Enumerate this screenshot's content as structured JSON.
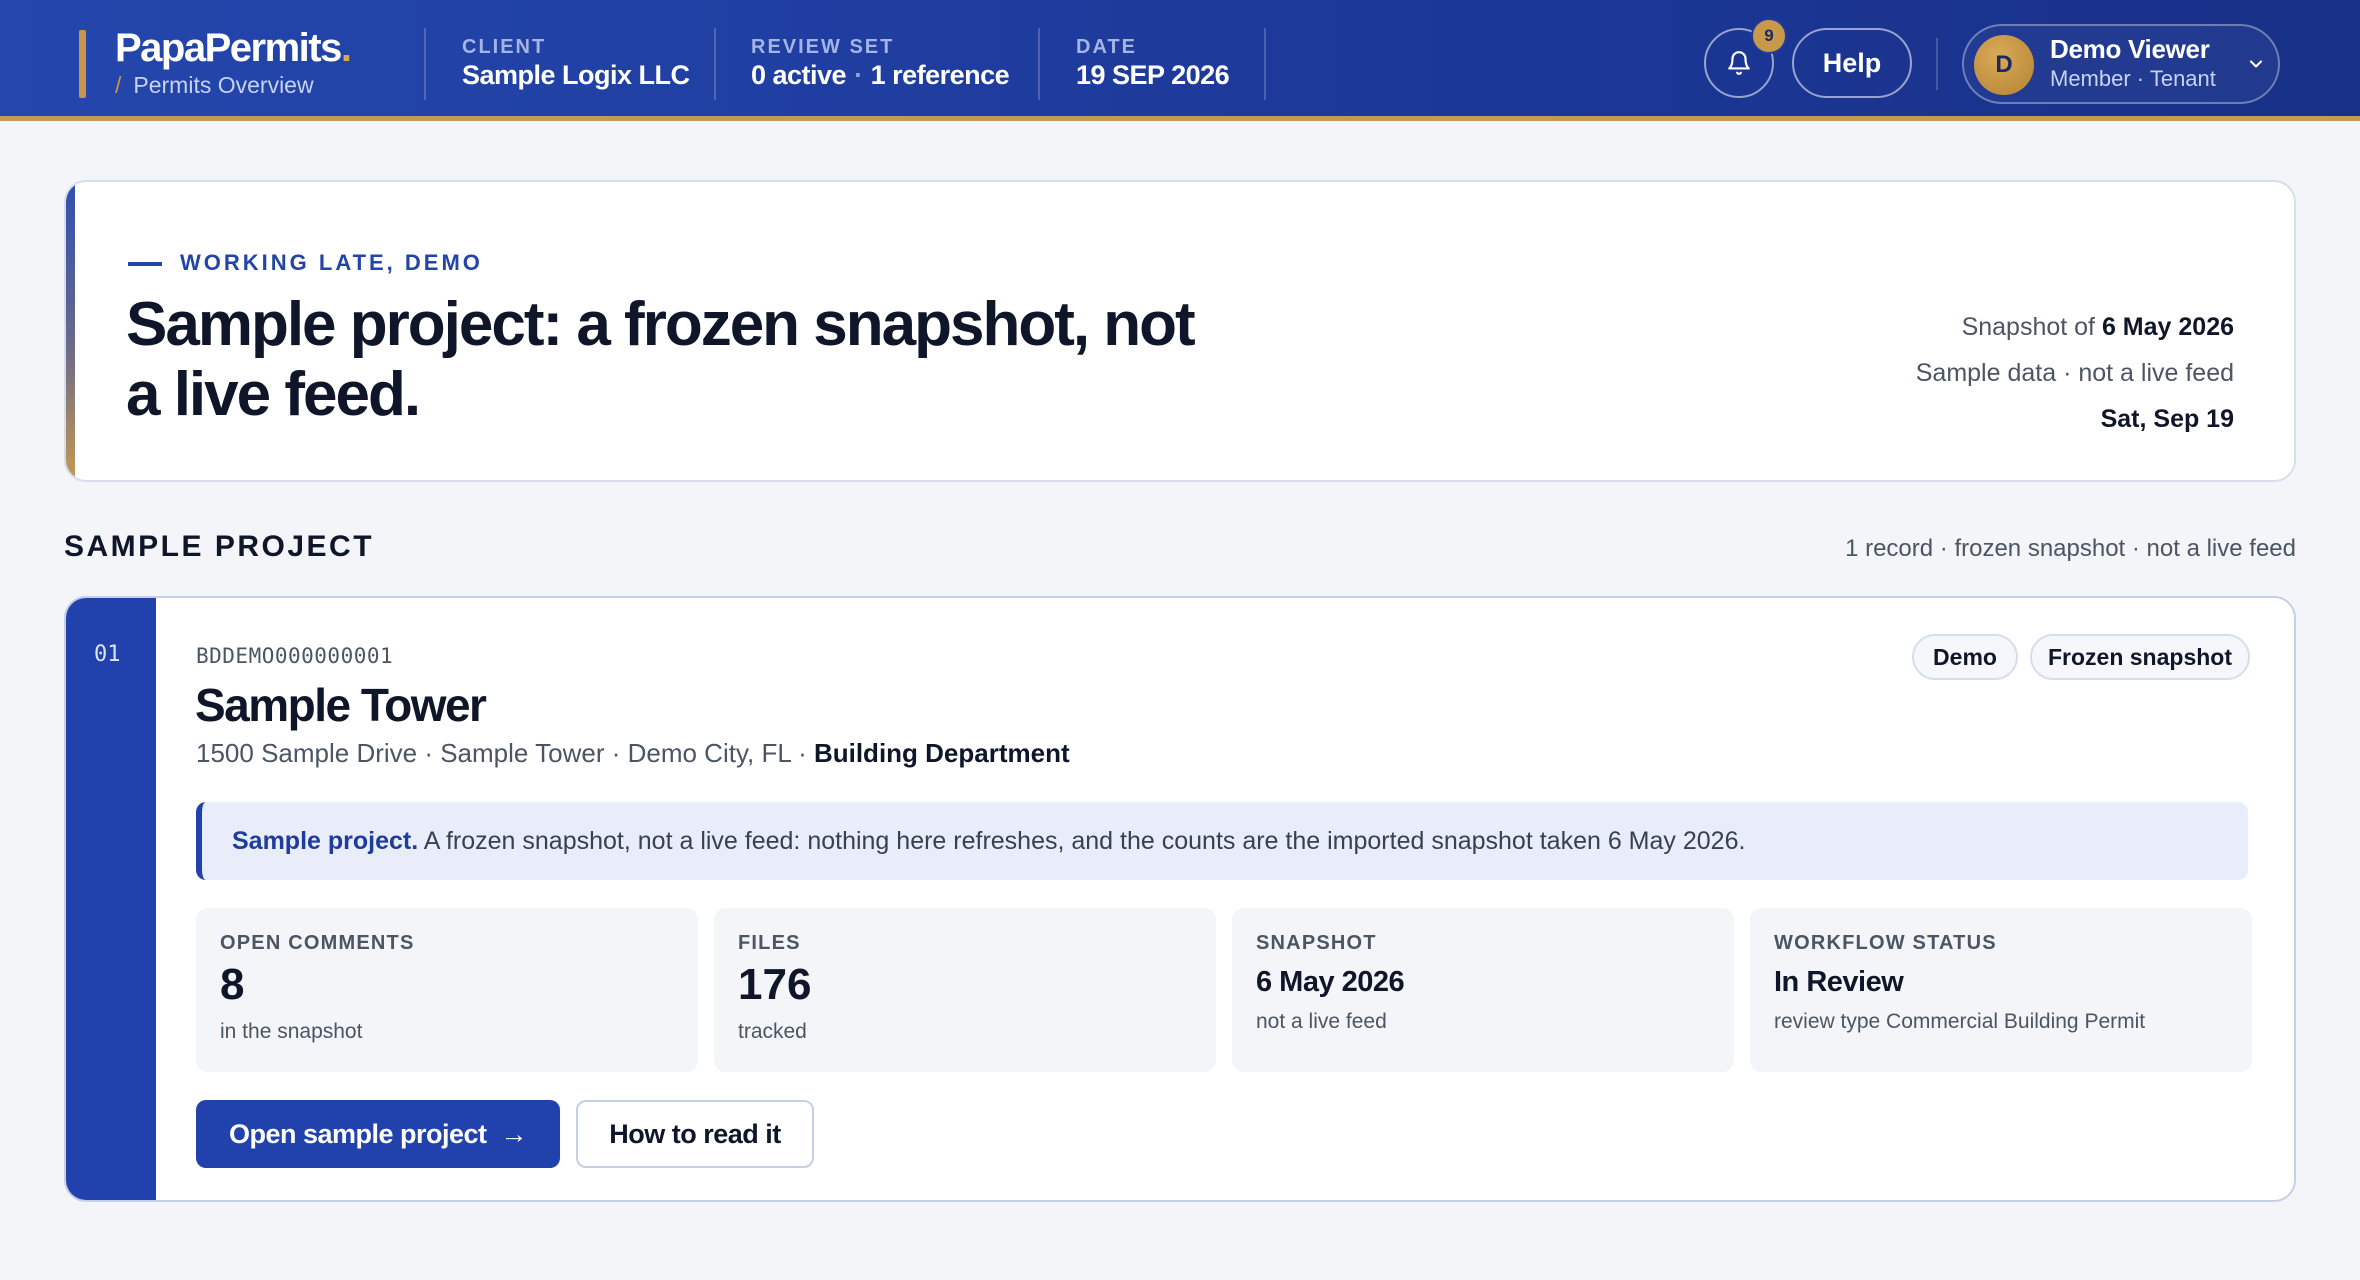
{
  "header": {
    "brand": "PapaPermits",
    "brand_dot": ".",
    "crumb_slash": "/",
    "crumb": "Permits Overview",
    "client_label": "CLIENT",
    "client_value": "Sample Logix LLC",
    "review_label": "REVIEW SET",
    "review_active": "0 active",
    "review_sep": "·",
    "review_reference": "1 reference",
    "date_label": "DATE",
    "date_value": "19 SEP 2026",
    "notifications_count": "9",
    "help_label": "Help",
    "user_initial": "D",
    "user_name": "Demo Viewer",
    "user_role": "Member · Tenant",
    "icons": [
      "bell-icon",
      "chevron-down-icon"
    ]
  },
  "hero": {
    "eyebrow": "WORKING LATE, DEMO",
    "title": "Sample project: a frozen snapshot, not a live feed.",
    "snapshot_prefix": "Snapshot of",
    "snapshot_date": "6 May 2026",
    "sample_note": "Sample data · not a live feed",
    "today": "Sat, Sep 19"
  },
  "section": {
    "title": "SAMPLE PROJECT",
    "meta": "1 record · frozen snapshot · not a live feed"
  },
  "project": {
    "number": "01",
    "id": "BDDEMO000000001",
    "name": "Sample Tower",
    "address": "1500 Sample Drive · Sample Tower · Demo City, FL · ",
    "department": "Building Department",
    "tags": [
      "Demo",
      "Frozen snapshot"
    ],
    "notice_bold": "Sample project.",
    "notice_text": " A frozen snapshot, not a live feed: nothing here refreshes, and the counts are the imported snapshot taken 6 May 2026.",
    "stats": {
      "open_comments": {
        "label": "OPEN COMMENTS",
        "value": "8",
        "sub": "in the snapshot"
      },
      "files": {
        "label": "FILES",
        "value": "176",
        "sub": "tracked"
      },
      "snapshot": {
        "label": "SNAPSHOT",
        "value": "6 May 2026",
        "sub": "not a live feed"
      },
      "workflow": {
        "label": "WORKFLOW STATUS",
        "value": "In Review",
        "sub": "review type Commercial Building Permit"
      }
    },
    "open_button": "Open sample project",
    "open_arrow": "→",
    "read_button": "How to read it"
  },
  "colors": {
    "header_start": "#2447ad",
    "header_end": "#183188",
    "accent_gold": "#c89645",
    "primary_blue": "#2142ad",
    "notice_bg": "#e8edf9",
    "page_bg": "#f3f5f9"
  }
}
